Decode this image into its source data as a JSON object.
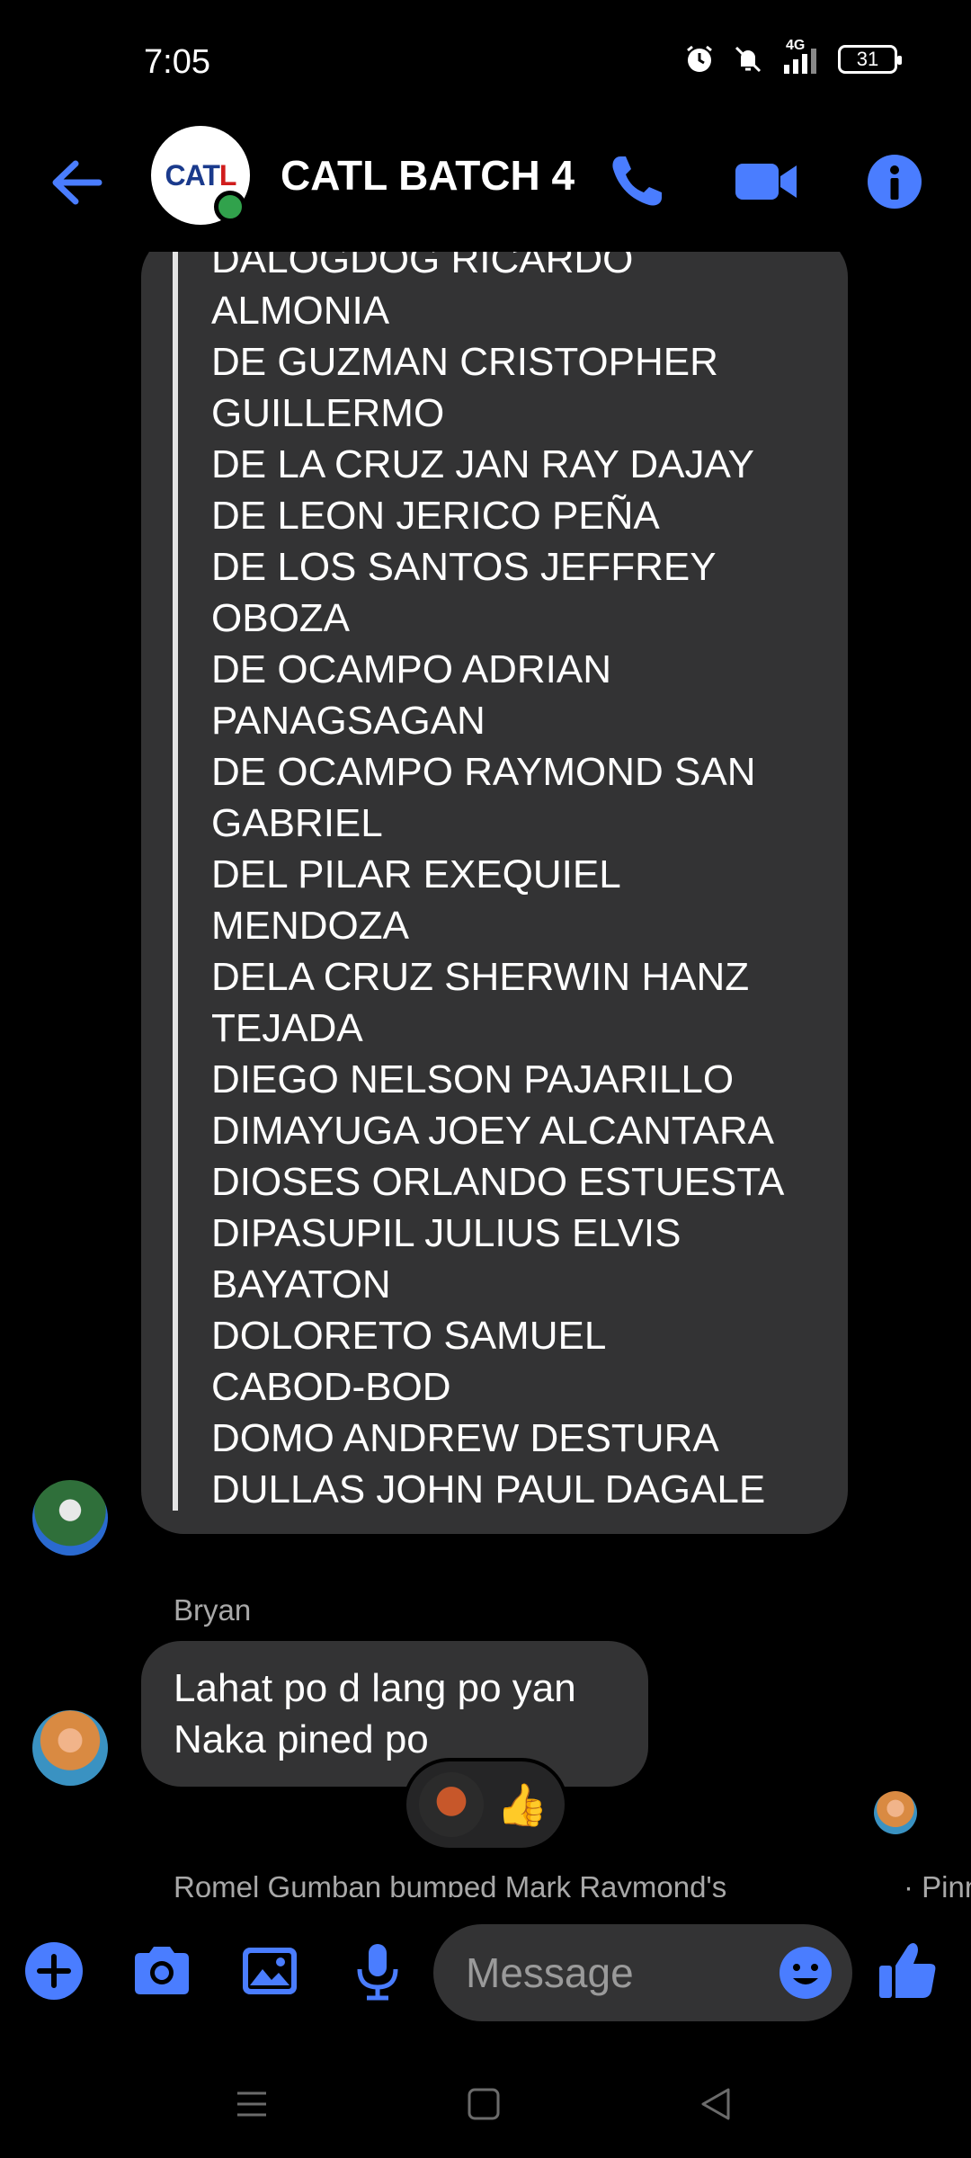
{
  "status_bar": {
    "time": "7:05",
    "network": "4G",
    "battery": "31"
  },
  "header": {
    "title": "CATL BATCH 4",
    "avatar_logo_main": "CAT",
    "avatar_logo_accent": "L"
  },
  "quoted_message": {
    "lines": [
      "DALOGDOG RICARDO",
      "ALMONIA",
      "DE GUZMAN CRISTOPHER",
      "GUILLERMO",
      "DE LA CRUZ JAN RAY DAJAY",
      "DE LEON JERICO PEÑA",
      "DE LOS SANTOS JEFFREY",
      "OBOZA",
      "DE OCAMPO ADRIAN",
      "PANAGSAGAN",
      "DE OCAMPO RAYMOND SAN",
      "GABRIEL",
      "DEL PILAR EXEQUIEL",
      "MENDOZA",
      "DELA CRUZ SHERWIN HANZ",
      "TEJADA",
      "DIEGO NELSON PAJARILLO",
      "DIMAYUGA JOEY ALCANTARA",
      "DIOSES ORLANDO ESTUESTA",
      "DIPASUPIL JULIUS ELVIS",
      "BAYATON",
      "DOLORETO SAMUEL",
      "CABOD-BOD",
      "DOMO ANDREW DESTURA",
      "DULLAS JOHN PAUL DAGALE"
    ]
  },
  "reply": {
    "sender": "Bryan",
    "lines": [
      "Lahat po d lang po yan",
      "Naka pined po"
    ]
  },
  "reaction": {
    "emoji": "👍"
  },
  "system_note": {
    "text": "Romel Gumban bumped Mark Raymond's",
    "suffix": "· Pinn"
  },
  "composer": {
    "placeholder": "Message"
  },
  "colors": {
    "accent": "#4a7dff",
    "bubble": "#333334",
    "online": "#31a24c"
  }
}
